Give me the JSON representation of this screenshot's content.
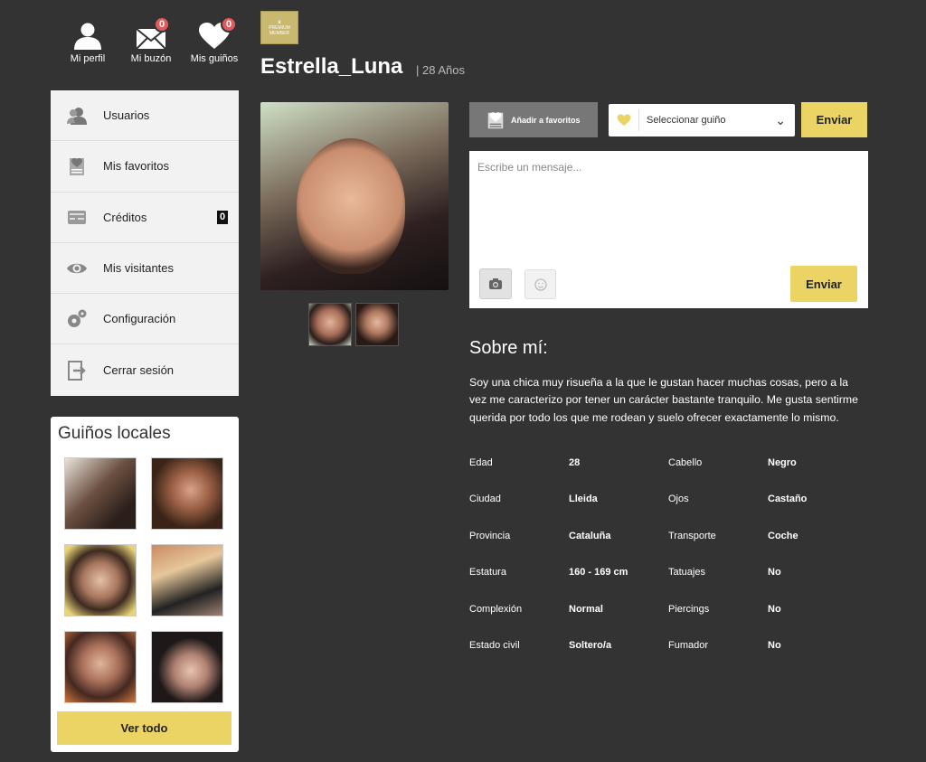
{
  "topnav": {
    "profile_label": "Mi perfil",
    "inbox_label": "Mi buzón",
    "inbox_count": "0",
    "winks_label": "Mis guiños",
    "winks_count": "0"
  },
  "menu": {
    "items": [
      {
        "label": "Usuarios",
        "icon": "users-icon"
      },
      {
        "label": "Mis favoritos",
        "icon": "favorites-icon"
      },
      {
        "label": "Créditos",
        "icon": "credits-icon",
        "badge": "0"
      },
      {
        "label": "Mis visitantes",
        "icon": "eye-icon"
      },
      {
        "label": "Configuración",
        "icon": "gear-icon"
      },
      {
        "label": "Cerrar sesión",
        "icon": "logout-icon"
      }
    ]
  },
  "locales": {
    "title": "Guiños locales",
    "button": "Ver todo"
  },
  "profile": {
    "badge_lines": [
      "PREMIUM",
      "MEMBER"
    ],
    "username": "Estrella_Luna",
    "age": "| 28 Años"
  },
  "actions": {
    "favorite_label": "Añadir a favoritos",
    "select_value": "Seleccionar guiño",
    "send_label": "Enviar"
  },
  "message": {
    "placeholder": "Escribe un mensaje...",
    "send_label": "Enviar"
  },
  "about": {
    "title": "Sobre mí:",
    "text": "Soy una chica muy risueña a la que le gustan hacer muchas cosas, pero a la vez me caracterizo por tener un carácter bastante tranquilo. Me gusta sentirme querida por todo los que me rodean y suelo ofrecer exactamente lo mismo."
  },
  "facts": [
    {
      "k1": "Edad",
      "v1": "28",
      "k2": "Cabello",
      "v2": "Negro"
    },
    {
      "k1": "Ciudad",
      "v1": "Lleida",
      "k2": "Ojos",
      "v2": "Castaño"
    },
    {
      "k1": "Provincia",
      "v1": "Cataluña",
      "k2": "Transporte",
      "v2": "Coche"
    },
    {
      "k1": "Estatura",
      "v1": "160 - 169 cm",
      "k2": "Tatuajes",
      "v2": "No"
    },
    {
      "k1": "Complexión",
      "v1": "Normal",
      "k2": "Piercings",
      "v2": "No"
    },
    {
      "k1": "Estado civil",
      "v1": "Soltero/a",
      "k2": "Fumador",
      "v2": "No"
    }
  ],
  "colors": {
    "background": "#333333",
    "accent": "#ebd463",
    "notification": "#e05b5b"
  }
}
